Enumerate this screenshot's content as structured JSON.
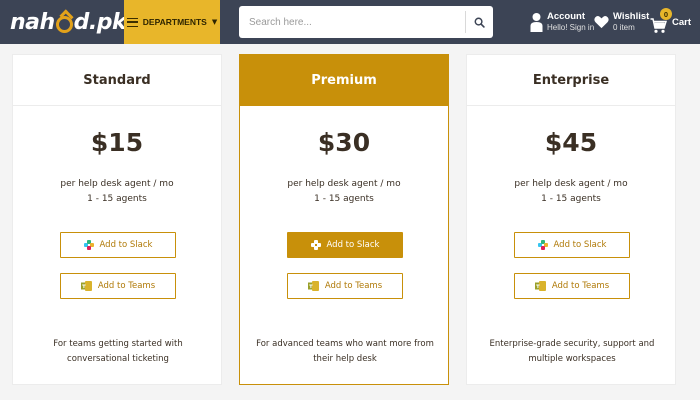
{
  "header": {
    "logo": {
      "part1": "nah",
      "part2": "e",
      "part3": "d.pk"
    },
    "departments_label": "DEPARTMENTS",
    "search": {
      "placeholder": "Search here..."
    },
    "account": {
      "title": "Account",
      "subtitle": "Hello! Sign in"
    },
    "wishlist": {
      "title": "Wishlist",
      "subtitle": "0 item"
    },
    "cart": {
      "title": "Cart",
      "count": "0"
    },
    "colors": {
      "bar": "#3c4455",
      "accent": "#e8b62a"
    }
  },
  "plans": [
    {
      "name": "Standard",
      "price": "$15",
      "per": "per help desk agent / mo",
      "agents": "1 - 15 agents",
      "slack_label": "Add to Slack",
      "teams_label": "Add to Teams",
      "description": "For teams getting started with conversational ticketing",
      "featured": false
    },
    {
      "name": "Premium",
      "price": "$30",
      "per": "per help desk agent / mo",
      "agents": "1 - 15 agents",
      "slack_label": "Add to Slack",
      "teams_label": "Add to Teams",
      "description": "For advanced teams who want more from their help desk",
      "featured": true
    },
    {
      "name": "Enterprise",
      "price": "$45",
      "per": "per help desk agent / mo",
      "agents": "1 - 15 agents",
      "slack_label": "Add to Slack",
      "teams_label": "Add to Teams",
      "description": "Enterprise-grade security, support and multiple workspaces",
      "featured": false
    }
  ],
  "icons": {
    "menu": "menu-icon",
    "search": "search-icon",
    "account": "user-icon",
    "wishlist": "heart-icon",
    "cart": "cart-icon",
    "slack": "slack-icon",
    "teams": "teams-icon"
  },
  "colors": {
    "featured": "#c8900a",
    "text": "#3a2f24"
  }
}
